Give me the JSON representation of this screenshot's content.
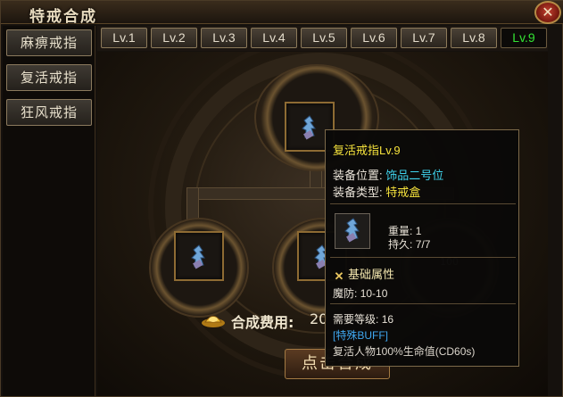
{
  "window": {
    "title": "特戒合成",
    "close_glyph": "✕"
  },
  "sidebar": {
    "items": [
      {
        "label": "麻痹戒指"
      },
      {
        "label": "复活戒指"
      },
      {
        "label": "狂风戒指"
      }
    ]
  },
  "levels": {
    "tabs": [
      "Lv.1",
      "Lv.2",
      "Lv.3",
      "Lv.4",
      "Lv.5",
      "Lv.6",
      "Lv.7",
      "Lv.8",
      "Lv.9"
    ],
    "active": "Lv.9"
  },
  "craft": {
    "cost_label": "合成费用:",
    "cost_value": "20",
    "button_label": "点击合成",
    "partial_number": "100"
  },
  "tooltip": {
    "title": "复活戒指Lv.9",
    "slot_key": "装备位置:",
    "slot_value": "饰品二号位",
    "type_key": "装备类型:",
    "type_value": "特戒盒",
    "weight_label": "重量:",
    "weight_value": "1",
    "durability_label": "持久:",
    "durability_value": "7/7",
    "section_title": "基础属性",
    "defense_label": "魔防:",
    "defense_value": "10-10",
    "level_req_label": "需要等级:",
    "level_req_value": "16",
    "buff_tag": "[特殊BUFF]",
    "buff_desc": "复活人物100%生命值(CD60s)"
  },
  "icons": {
    "ring": "ring-icon",
    "gold": "gold-ingot-icon",
    "close": "close-icon",
    "swords": "crossed-swords-icon"
  },
  "colors": {
    "active_tab_text": "#33e233",
    "tooltip_title": "#f5e23c",
    "tooltip_cyan": "#3fd4ee",
    "tooltip_buff": "#3fa7f0"
  }
}
